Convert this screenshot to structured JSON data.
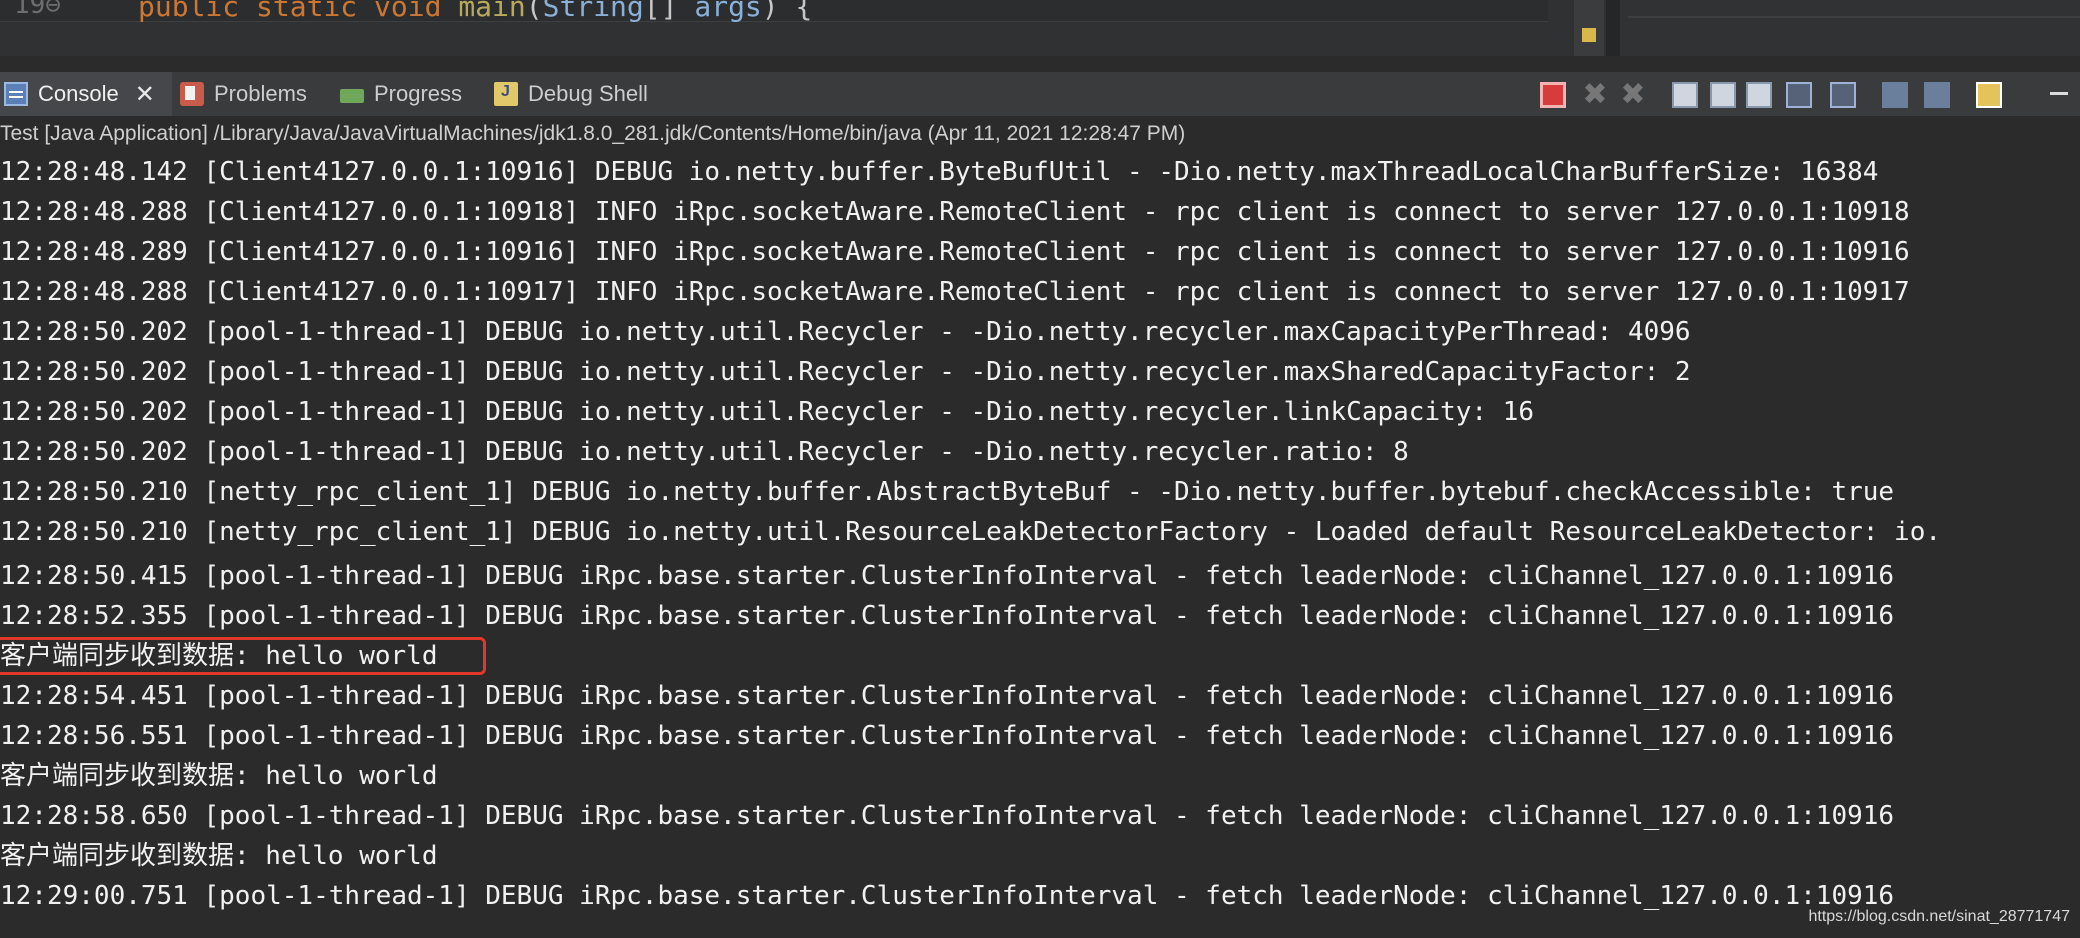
{
  "editor": {
    "line_number": "19⊖",
    "code": {
      "kw1": "public",
      "kw2": "static",
      "kw3": "void",
      "fn": "main",
      "paren_open": "(",
      "type": "String",
      "brackets": "[]",
      "arg": "args",
      "paren_close": ") {"
    }
  },
  "tabs": [
    {
      "label": "Console",
      "icon": "console-icon",
      "active": true,
      "close": "✕"
    },
    {
      "label": "Problems",
      "icon": "problems-icon"
    },
    {
      "label": "Progress",
      "icon": "progress-icon"
    },
    {
      "label": "Debug Shell",
      "icon": "debug-shell-icon"
    }
  ],
  "toolbar": {
    "icons": [
      "terminate-icon",
      "remove-launch-icon",
      "remove-all-terminated-icon",
      "clear-console-icon",
      "scroll-lock-icon",
      "word-wrap-icon",
      "show-on-stdout-icon",
      "show-on-stderr-icon",
      "pin-console-icon",
      "display-selected-console-icon",
      "open-console-icon",
      "minimize-icon"
    ],
    "accent_stop": "#d73b3b"
  },
  "launch_line": "Test [Java Application] /Library/Java/JavaVirtualMachines/jdk1.8.0_281.jdk/Contents/Home/bin/java  (Apr 11, 2021 12:28:47 PM)",
  "log_lines": [
    "12:28:48.142 [Client4127.0.0.1:10916] DEBUG io.netty.buffer.ByteBufUtil - -Dio.netty.maxThreadLocalCharBufferSize: 16384",
    "12:28:48.288 [Client4127.0.0.1:10918] INFO iRpc.socketAware.RemoteClient - rpc client is connect to server 127.0.0.1:10918",
    "12:28:48.289 [Client4127.0.0.1:10916] INFO iRpc.socketAware.RemoteClient - rpc client is connect to server 127.0.0.1:10916",
    "12:28:48.288 [Client4127.0.0.1:10917] INFO iRpc.socketAware.RemoteClient - rpc client is connect to server 127.0.0.1:10917",
    "12:28:50.202 [pool-1-thread-1] DEBUG io.netty.util.Recycler - -Dio.netty.recycler.maxCapacityPerThread: 4096",
    "12:28:50.202 [pool-1-thread-1] DEBUG io.netty.util.Recycler - -Dio.netty.recycler.maxSharedCapacityFactor: 2",
    "12:28:50.202 [pool-1-thread-1] DEBUG io.netty.util.Recycler - -Dio.netty.recycler.linkCapacity: 16",
    "12:28:50.202 [pool-1-thread-1] DEBUG io.netty.util.Recycler - -Dio.netty.recycler.ratio: 8",
    "12:28:50.210 [netty_rpc_client_1] DEBUG io.netty.buffer.AbstractByteBuf - -Dio.netty.buffer.bytebuf.checkAccessible: true",
    "12:28:50.210 [netty_rpc_client_1] DEBUG io.netty.util.ResourceLeakDetectorFactory - Loaded default ResourceLeakDetector: io.",
    "12:28:50.415 [pool-1-thread-1] DEBUG iRpc.base.starter.ClusterInfoInterval - fetch leaderNode: cliChannel_127.0.0.1:10916",
    "12:28:52.355 [pool-1-thread-1] DEBUG iRpc.base.starter.ClusterInfoInterval - fetch leaderNode: cliChannel_127.0.0.1:10916",
    "客户端同步收到数据: hello world",
    "12:28:54.451 [pool-1-thread-1] DEBUG iRpc.base.starter.ClusterInfoInterval - fetch leaderNode: cliChannel_127.0.0.1:10916",
    "12:28:56.551 [pool-1-thread-1] DEBUG iRpc.base.starter.ClusterInfoInterval - fetch leaderNode: cliChannel_127.0.0.1:10916",
    "客户端同步收到数据: hello world",
    "12:28:58.650 [pool-1-thread-1] DEBUG iRpc.base.starter.ClusterInfoInterval - fetch leaderNode: cliChannel_127.0.0.1:10916",
    "客户端同步收到数据: hello world",
    "12:29:00.751 [pool-1-thread-1] DEBUG iRpc.base.starter.ClusterInfoInterval - fetch leaderNode: cliChannel_127.0.0.1:10916"
  ],
  "highlight_color": "#e0392a",
  "watermark": "https://blog.csdn.net/sinat_28771747"
}
